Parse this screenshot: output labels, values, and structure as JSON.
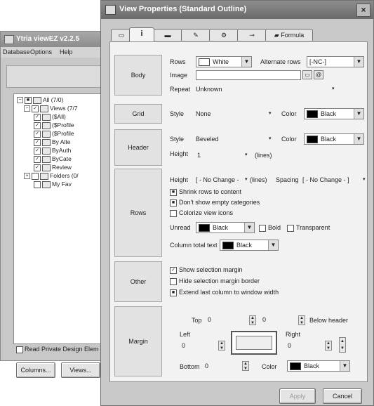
{
  "back_window": {
    "title": "Ytria viewEZ v2.2.5",
    "menu": [
      "Database",
      "Options",
      "Help"
    ],
    "tree": [
      {
        "label": "All (7/0)",
        "indent": 0
      },
      {
        "label": "Views (7/7",
        "indent": 1
      },
      {
        "label": "($All)",
        "indent": 2
      },
      {
        "label": "($Profile",
        "indent": 2
      },
      {
        "label": "($Profile",
        "indent": 2
      },
      {
        "label": "By Alte",
        "indent": 2
      },
      {
        "label": "ByAuth",
        "indent": 2
      },
      {
        "label": "ByCate",
        "indent": 2
      },
      {
        "label": "Review",
        "indent": 2
      },
      {
        "label": "Folders (0/",
        "indent": 1
      },
      {
        "label": "My Fav",
        "indent": 2
      }
    ],
    "read_private_label": "Read Private Design Elem",
    "columns_button": "Columns...",
    "views_button": "Views..."
  },
  "dialog": {
    "title": "View Properties (Standard Outline)",
    "close_label": "×",
    "tabs": [
      "i",
      "",
      "",
      "",
      "",
      "",
      "Formula"
    ],
    "body": {
      "section_label": "Body",
      "rows_label": "Rows",
      "rows_value": "White",
      "alternate_rows_label": "Alternate rows",
      "alternate_rows_value": "[-NC-]",
      "image_label": "Image",
      "image_value": "",
      "repeat_label": "Repeat",
      "repeat_value": "Unknown"
    },
    "grid": {
      "section_label": "Grid",
      "style_label": "Style",
      "style_value": "None",
      "color_label": "Color",
      "color_value": "Black"
    },
    "header": {
      "section_label": "Header",
      "style_label": "Style",
      "style_value": "Beveled",
      "color_label": "Color",
      "color_value": "Black",
      "height_label": "Height",
      "height_value": "1",
      "height_unit": "(lines)"
    },
    "rows": {
      "section_label": "Rows",
      "height_label": "Height",
      "height_value": "[ - No Change -",
      "height_unit": "(lines)",
      "spacing_label": "Spacing",
      "spacing_value": "[ - No Change - ]",
      "shrink_label": "Shrink rows to content",
      "dont_show_empty_label": "Don't show empty categories",
      "colorize_label": "Colorize view icons",
      "unread_label": "Unread",
      "unread_value": "Black",
      "bold_label": "Bold",
      "transparent_label": "Transparent",
      "column_total_label": "Column total text",
      "column_total_value": "Black"
    },
    "other": {
      "section_label": "Other",
      "show_selection_label": "Show selection margin",
      "hide_selection_border_label": "Hide selection margin border",
      "extend_last_label": "Extend last column to window width"
    },
    "margin": {
      "section_label": "Margin",
      "top_label": "Top",
      "top_value": "0",
      "below_value": "0",
      "below_header_label": "Below header",
      "left_label": "Left",
      "left_value": "0",
      "right_label": "Right",
      "right_value": "0",
      "bottom_label": "Bottom",
      "bottom_value": "0",
      "color_label": "Color",
      "color_value": "Black"
    },
    "apply_button": "Apply",
    "cancel_button": "Cancel"
  }
}
